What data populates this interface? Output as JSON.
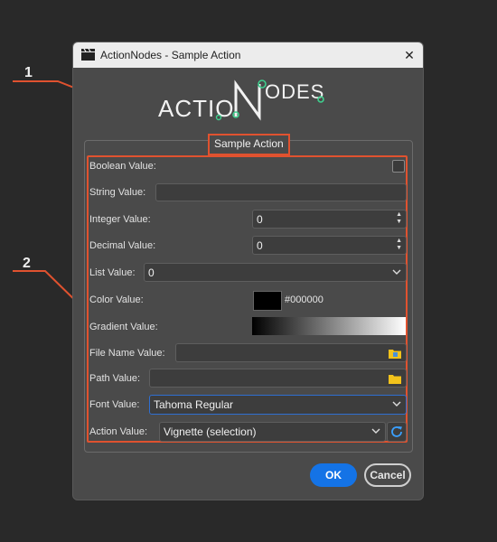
{
  "window": {
    "title": "ActionNodes - Sample Action",
    "close_glyph": "✕",
    "logo_text": "ACTIONODES"
  },
  "annotations": {
    "one": "1",
    "two": "2",
    "color": "#e0522f"
  },
  "group": {
    "title": "Sample Action"
  },
  "fields": {
    "boolean": {
      "label": "Boolean Value:",
      "checked": false
    },
    "string": {
      "label": "String Value:",
      "value": ""
    },
    "integer": {
      "label": "Integer Value:",
      "value": "0"
    },
    "decimal": {
      "label": "Decimal Value:",
      "value": "0"
    },
    "list": {
      "label": "List Value:",
      "value": "0"
    },
    "color": {
      "label": "Color Value:",
      "value": "#000000"
    },
    "gradient": {
      "label": "Gradient Value:"
    },
    "filename": {
      "label": "File Name Value:",
      "value": ""
    },
    "path": {
      "label": "Path Value:",
      "value": ""
    },
    "font": {
      "label": "Font Value:",
      "value": "Tahoma Regular"
    },
    "action": {
      "label": "Action Value:",
      "value": "Vignette (selection)"
    }
  },
  "buttons": {
    "ok": "OK",
    "cancel": "Cancel"
  },
  "colors": {
    "accent": "#1473e6",
    "logo_green": "#3fcf8e",
    "folder": "#f2c21b"
  }
}
